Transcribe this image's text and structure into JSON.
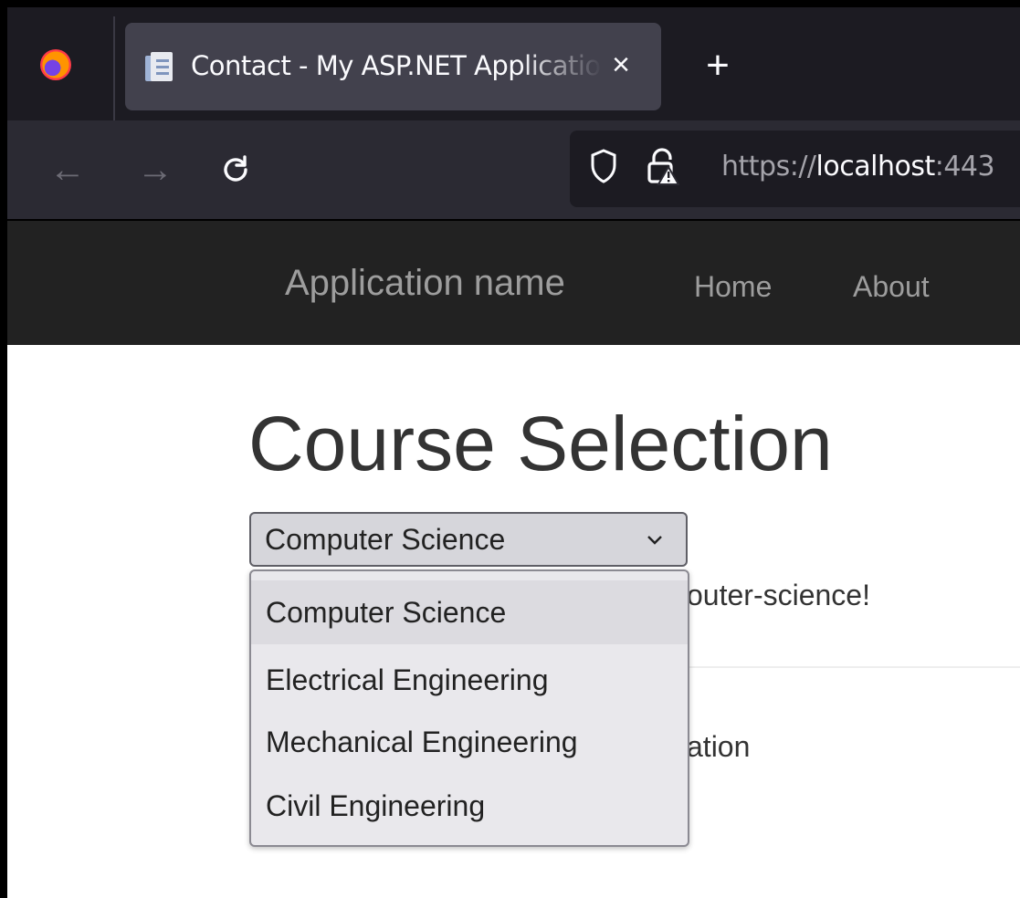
{
  "browser": {
    "tab_title": "Contact - My ASP.NET Application",
    "tab_close": "×",
    "new_tab": "+",
    "back": "←",
    "forward": "→",
    "reload": "C",
    "url_scheme": "https://",
    "url_host": "localhost",
    "url_rest": ":443"
  },
  "site": {
    "brand": "Application name",
    "nav": [
      {
        "label": "Home"
      },
      {
        "label": "About"
      }
    ]
  },
  "main": {
    "title": "Course Selection",
    "select": {
      "value": "Computer Science",
      "options": [
        "Computer Science",
        "Electrical Engineering",
        "Mechanical Engineering",
        "Civil Engineering"
      ]
    },
    "partial_message": "outer-science!",
    "partial_footer": "ation"
  },
  "colors": {
    "tab_bg": "#42414d",
    "toolbar_bg": "#2b2a33",
    "site_header_bg": "#222222",
    "dropdown_bg": "#e9e8ec"
  }
}
